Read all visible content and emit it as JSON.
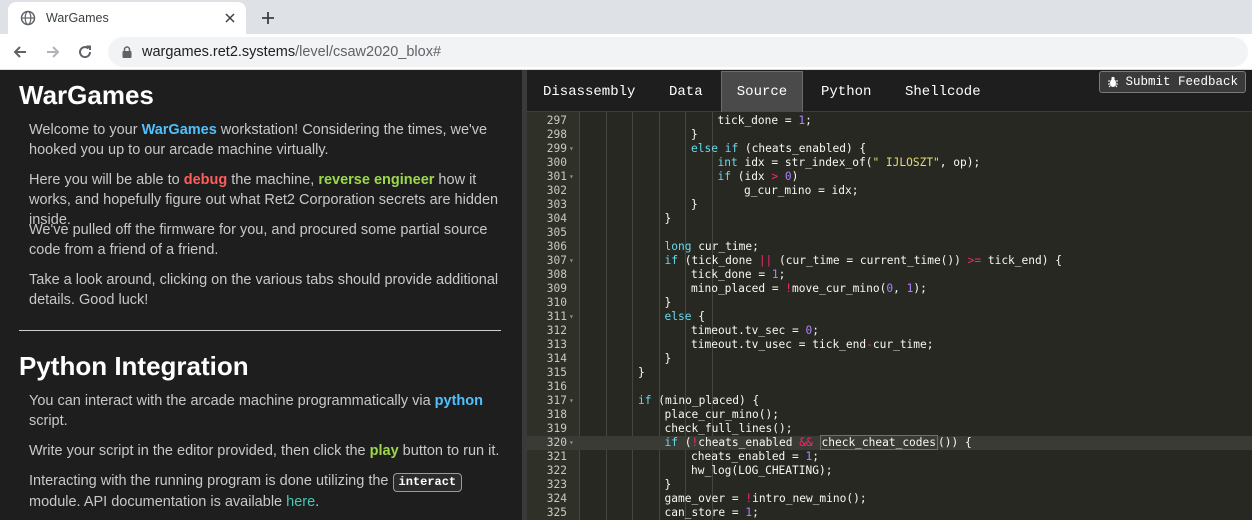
{
  "browser": {
    "tab_title": "WarGames",
    "url_host": "wargames.ret2.systems",
    "url_path": "/level/csaw2020_blox#"
  },
  "left": {
    "heading1": "WarGames",
    "intro": {
      "p1_a": "Welcome to your ",
      "p1_hl": "WarGames",
      "p1_b": " workstation! Considering the times, we've hooked you up to our arcade machine virtually.",
      "p2_a": "Here you will be able to ",
      "p2_debug": "debug",
      "p2_b": " the machine, ",
      "p2_re": "reverse engineer",
      "p2_c": " how it works, and hopefully figure out what Ret2 Corporation secrets are hidden inside.",
      "p3": "We've pulled off the firmware for you, and procured some partial source code from a friend of a friend.",
      "p4": "Take a look around, clicking on the various tabs should provide additional details. Good luck!"
    },
    "heading2": "Python Integration",
    "python": {
      "p1_a": "You can interact with the arcade machine programmatically via ",
      "p1_hl": "python",
      "p1_b": " script.",
      "p2_a": "Write your script in the editor provided, then click the ",
      "p2_hl": "play",
      "p2_b": " button to run it.",
      "p3_a": "Interacting with the running program is done utilizing the ",
      "p3_code": "interact",
      "p3_b": " module. API documentation is available ",
      "p3_link": "here",
      "p3_c": "."
    }
  },
  "ide": {
    "tabs": [
      "Disassembly",
      "Data",
      "Source",
      "Python",
      "Shellcode"
    ],
    "active_tab": "Source",
    "feedback_label": "Submit Feedback"
  },
  "source_lines": [
    {
      "n": "297",
      "fold": false,
      "ind": 5,
      "t": "tick_done = 1;"
    },
    {
      "n": "298",
      "fold": false,
      "ind": 4,
      "t": "}"
    },
    {
      "n": "299",
      "fold": true,
      "ind": 4,
      "t": "else if (cheats_enabled) {"
    },
    {
      "n": "300",
      "fold": false,
      "ind": 5,
      "t": "int idx = str_index_of(\" IJLOSZT\", op);"
    },
    {
      "n": "301",
      "fold": true,
      "ind": 5,
      "t": "if (idx > 0)"
    },
    {
      "n": "302",
      "fold": false,
      "ind": 6,
      "t": "g_cur_mino = idx;"
    },
    {
      "n": "303",
      "fold": false,
      "ind": 4,
      "t": "}"
    },
    {
      "n": "304",
      "fold": false,
      "ind": 3,
      "t": "}"
    },
    {
      "n": "305",
      "fold": false,
      "ind": 0,
      "t": ""
    },
    {
      "n": "306",
      "fold": false,
      "ind": 3,
      "t": "long cur_time;"
    },
    {
      "n": "307",
      "fold": true,
      "ind": 3,
      "t": "if (tick_done || (cur_time = current_time()) >= tick_end) {"
    },
    {
      "n": "308",
      "fold": false,
      "ind": 4,
      "t": "tick_done = 1;"
    },
    {
      "n": "309",
      "fold": false,
      "ind": 4,
      "t": "mino_placed = !move_cur_mino(0, 1);"
    },
    {
      "n": "310",
      "fold": false,
      "ind": 3,
      "t": "}"
    },
    {
      "n": "311",
      "fold": true,
      "ind": 3,
      "t": "else {"
    },
    {
      "n": "312",
      "fold": false,
      "ind": 4,
      "t": "timeout.tv_sec = 0;"
    },
    {
      "n": "313",
      "fold": false,
      "ind": 4,
      "t": "timeout.tv_usec = tick_end-cur_time;"
    },
    {
      "n": "314",
      "fold": false,
      "ind": 3,
      "t": "}"
    },
    {
      "n": "315",
      "fold": false,
      "ind": 2,
      "t": "}"
    },
    {
      "n": "316",
      "fold": false,
      "ind": 0,
      "t": ""
    },
    {
      "n": "317",
      "fold": true,
      "ind": 2,
      "t": "if (mino_placed) {"
    },
    {
      "n": "318",
      "fold": false,
      "ind": 3,
      "t": "place_cur_mino();"
    },
    {
      "n": "319",
      "fold": false,
      "ind": 3,
      "t": "check_full_lines();"
    },
    {
      "n": "320",
      "fold": true,
      "ind": 3,
      "t": "if (!cheats_enabled && check_cheat_codes()) {",
      "highlight": true
    },
    {
      "n": "321",
      "fold": false,
      "ind": 4,
      "t": "cheats_enabled = 1;"
    },
    {
      "n": "322",
      "fold": false,
      "ind": 4,
      "t": "hw_log(LOG_CHEATING);"
    },
    {
      "n": "323",
      "fold": false,
      "ind": 3,
      "t": "}"
    },
    {
      "n": "324",
      "fold": false,
      "ind": 3,
      "t": "game_over = !intro_new_mino();"
    },
    {
      "n": "325",
      "fold": false,
      "ind": 3,
      "t": "can_store = 1;"
    }
  ],
  "theme": {
    "keyword": "#66d9ef",
    "number": "#ae81ff",
    "string": "#e6db74",
    "operator": "#f92672",
    "editor_bg": "#272822"
  }
}
